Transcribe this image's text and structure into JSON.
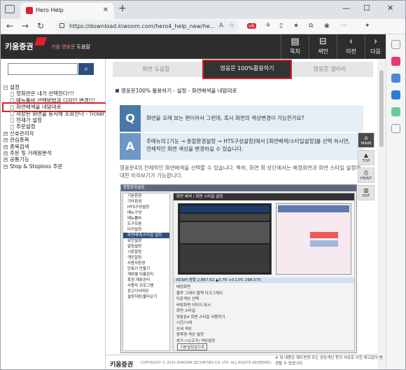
{
  "browser": {
    "tab_title": "Hero Help",
    "url": "https://download.kiwoom.com/hero4_help_new/he..."
  },
  "header": {
    "logo": "키움증권",
    "subtitle_brand": "키움 영웅문",
    "subtitle_rest": "도움말",
    "buttons": [
      "목차",
      "색인",
      "이전",
      "다음"
    ]
  },
  "tree": [
    {
      "label": "설정",
      "type": "folder-open",
      "indent": 0
    },
    {
      "label": "첫화면은 내가 선택한다!!!",
      "type": "doc",
      "indent": 1
    },
    {
      "label": "메뉴툴바 선택방법과 디자인 변경!!!",
      "type": "doc",
      "indent": 1
    },
    {
      "label": "화면배색을 내맘대로",
      "type": "doc",
      "indent": 1,
      "highlight": true
    },
    {
      "label": "저장된 화면을 동시에 조회한다 - Ticker",
      "type": "doc",
      "indent": 1
    },
    {
      "label": "현재가 설정",
      "type": "doc",
      "indent": 1
    },
    {
      "label": "주문설정",
      "type": "doc",
      "indent": 1
    },
    {
      "label": "신호관리자",
      "type": "folder",
      "indent": 0
    },
    {
      "label": "관심종목",
      "type": "folder",
      "indent": 0
    },
    {
      "label": "종목검색",
      "type": "folder",
      "indent": 0
    },
    {
      "label": "주문 및 거래원분석",
      "type": "folder",
      "indent": 0
    },
    {
      "label": "공통기능",
      "type": "folder",
      "indent": 0
    },
    {
      "label": "Stop & Stoploss 주문",
      "type": "folder",
      "indent": 0
    }
  ],
  "main": {
    "tabs": [
      "화면 도움말",
      "영웅문 100%활용하기",
      "영웅문 갤러리"
    ],
    "breadcrumb": "영웅문100% 활용하기 - 설정 - 화면배색을 내맘대로",
    "question_badge": "Q",
    "question": "화면을 오래 보는 편이라서 그런데, 혹시 화면의 색상변경이 가능한가요?",
    "answer_badge": "A",
    "answer": "주메뉴의 [기능 → 종합환경설정 → HTS구성설정]에서 [화면배색/스타일설정]를 선택 하시면, 전체적인 화면 색상을 변경하실 수 있습니다.",
    "paragraph": "영웅문4의 전체적인 화면배색을 선택할 수 있습니다. 특히, 화면 최 상단에서는 배경화면과 화면 스타일 설정에 대한 미리보기가 가능합니다."
  },
  "screenshot": {
    "title": "종합환경설정",
    "bar": "화면 배색 / 화면 스타일 설정",
    "left_items": [
      "기본환경",
      "기타환경",
      "HTS구성설정",
      "메뉴구성",
      "메뉴툴바",
      "도구모음",
      "티커설정",
      "화면배색/스타일 설정",
      "보안설정",
      "알림설정",
      "시장알림",
      "개인알림",
      "사용자환경",
      "단축키 만들기",
      "계좌별 이름관리",
      "특정 계좌관리",
      "사용자 프로그램",
      "광고지식마당",
      "설정저장/불러오기"
    ],
    "kospi": "KOSPI 종합   2,867.62  ▲3.76  +0.13%  298,575",
    "options": [
      "배경화면",
      "블루  그레이  블랙  다크그레이",
      "다운색상 선택",
      "바탕화면 이미지 표시",
      "화면 스타일",
      "영웅문4 화면 스타일 사용하기",
      "시간/시세",
      "상세 색상",
      "종목명 색상 설정",
      "호가 (시/고가) 색상설정"
    ],
    "reset": "기본설정값으로"
  },
  "right_buttons": [
    "MAIN",
    "TOP",
    "PRINT",
    "PDF"
  ],
  "footer": {
    "logo": "키움증권",
    "copyright": "COPYRIGHT © 2015 KIWOOM SECURITIES CO. LTD. ALL RIGHTS RESERVED.",
    "note": "※ 위 내용은 제도변경 또는 성능개선 등의 사유로 사전 예고없이 변경될 수 있습니다."
  }
}
